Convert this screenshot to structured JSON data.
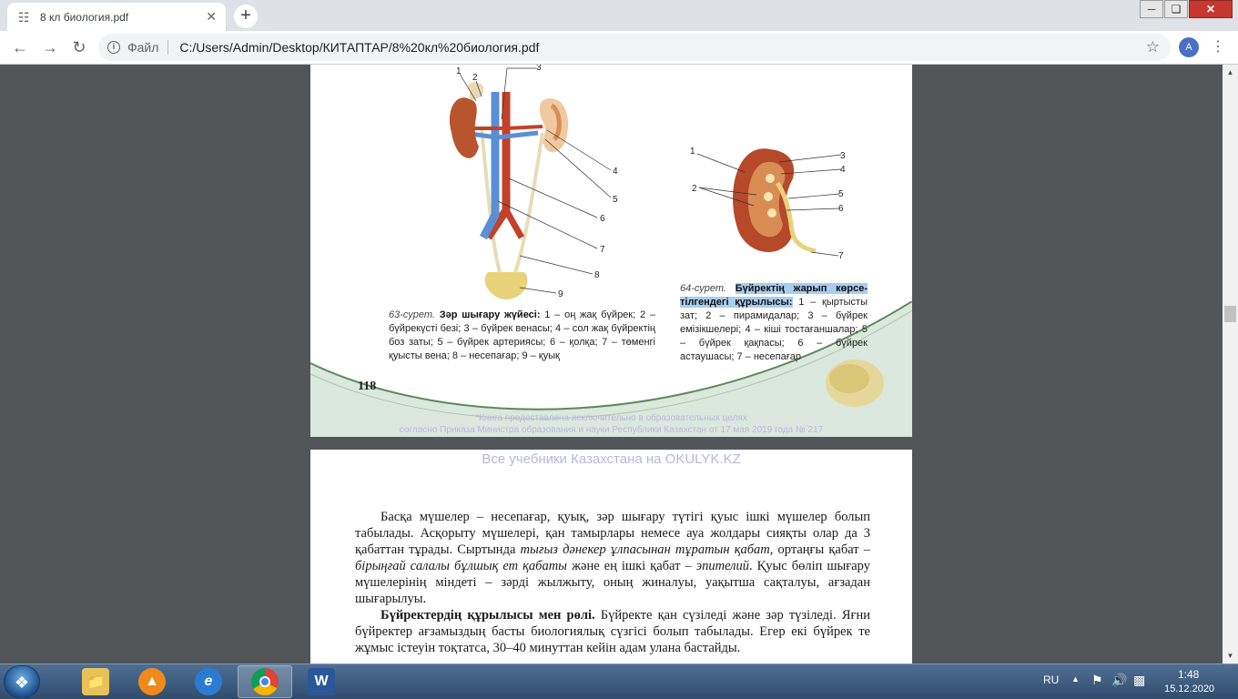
{
  "browser": {
    "tab_title": "8 кл биология.pdf",
    "address_scheme": "Файл",
    "address_url": "C:/Users/Admin/Desktop/КИТАПТАР/8%20кл%20биология.pdf",
    "profile_initial": "A"
  },
  "page1": {
    "fig63": {
      "labels": [
        "1",
        "2",
        "3",
        "4",
        "5",
        "6",
        "7",
        "8",
        "9"
      ],
      "caption_prefix": "63-сурет.",
      "caption_title": "Зәр шығару жүйесі:",
      "caption_text": "1 – оң жақ бүйрек; 2 – бүйрекүсті безі; 3 – бүйрек венасы; 4 – сол жақ бүйректің боз заты; 5 – бүйрек артериясы; 6 – қолқа; 7 – төменгі қуысты вена; 8 – несепағар; 9 – қуық"
    },
    "fig64": {
      "labels": [
        "1",
        "2",
        "3",
        "4",
        "5",
        "6",
        "7"
      ],
      "caption_prefix": "64-сурет.",
      "caption_title": "Бүйректің жарып көрсе-тілгендегі құрылысы:",
      "caption_text": "1 – қыртысты зат; 2 – пирамидалар; 3 – бүйрек емізікшелері; 4 – кіші тостағаншалар; 5 – бүйрек қақпасы; 6 – бүйрек астаушасы; 7 – несепағар"
    },
    "page_number": "118",
    "watermark_line1": "*Книга предоставлена исключительно в образовательных целях",
    "watermark_line2": "согласно Приказа Министра образования и науки Республики Казахстан от 17 мая 2019 года № 217"
  },
  "page2": {
    "watermark": "Все учебники Казахстана на OKULYK.KZ",
    "para1": {
      "t1": "Басқа мүшелер – несепағар, қуық, зәр шығару түтігі қуыс ішкі мүшелер болып табылады. Асқорыту мүшелері, қан тамырлары немесе ауа жолдары сияқты олар да 3 қабаттан тұрады. Сыртында ",
      "i1": "тығыз дәнекер ұлпасынан тұратын қабат",
      "t2": ", ортаңғы қабат – ",
      "i2": "бірыңғай салалы бұлшық ет қабаты",
      "t3": " және ең ішкі қабат – ",
      "i3": "эпителий",
      "t4": ". Қуыс бөліп шығару мүшелерінің міндеті – зәрді жылжыту, оның жиналуы, уақытша сақталуы, ағзадан шығарылуы."
    },
    "para2": {
      "bold": "Бүйректердің құрылысы мен рөлі.",
      "text": " Бүйректе қан сүзіледі және зәр түзіледі. Яғни бүйректер ағзамыздың басты биологиялық сүзгісі болып табылады. Егер екі бүйрек те жұмыс істеуін тоқтатса, 30–40 минуттан кейін адам улана бастайды."
    }
  },
  "taskbar": {
    "language": "RU",
    "time": "1:48",
    "date": "15.12.2020"
  },
  "icons": [
    "pdf-icon",
    "close-icon",
    "plus-icon",
    "back-icon",
    "forward-icon",
    "reload-icon",
    "info-icon",
    "star-icon",
    "menu-icon",
    "windows-start-icon",
    "folder-icon",
    "avast-icon",
    "ie-icon",
    "chrome-icon",
    "word-icon",
    "flag-icon",
    "speaker-icon",
    "network-icon"
  ]
}
